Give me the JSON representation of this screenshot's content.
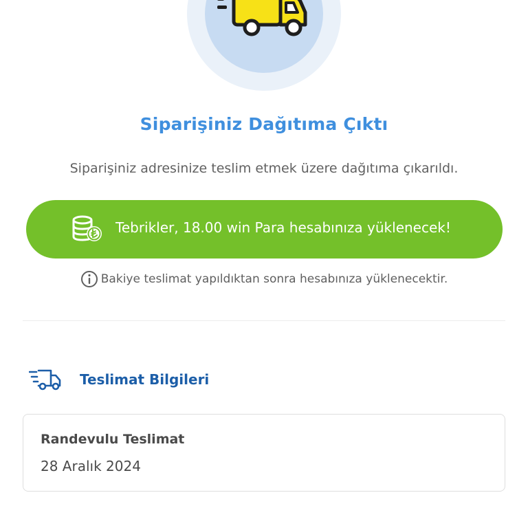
{
  "hero": {
    "icon": "delivery-truck-icon",
    "colors": {
      "outer_circle": "#eaf1f9",
      "inner_circle": "#c7dbf2",
      "truck": "#f7e117"
    }
  },
  "status": {
    "title": "Siparişiniz Dağıtıma Çıktı",
    "description": "Siparişiniz adresinize teslim etmek üzere dağıtıma çıkarıldı."
  },
  "reward": {
    "icon": "coin-stack-icon",
    "message": "Tebrikler, 18.00 win Para hesabınıza yüklenecek!",
    "color": "#74c02a"
  },
  "info_note": {
    "icon": "info-icon",
    "text": "Bakiye teslimat yapıldıktan sonra hesabınıza yüklenecektir."
  },
  "delivery_section": {
    "icon": "fast-delivery-truck-icon",
    "title": "Teslimat Bilgileri",
    "card": {
      "type": "Randevulu Teslimat",
      "date": "28 Aralık 2024"
    }
  },
  "colors": {
    "title_blue": "#3f8fde",
    "section_blue": "#1c5ea8",
    "text_gray": "#616161"
  }
}
